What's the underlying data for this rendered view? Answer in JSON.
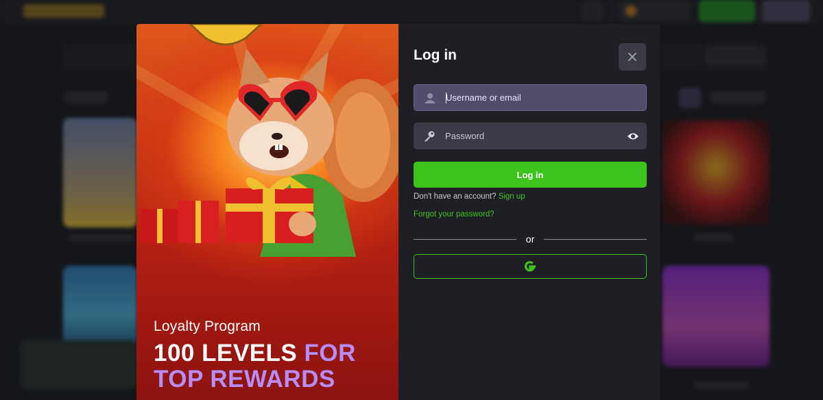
{
  "modal": {
    "title": "Log in",
    "username": {
      "placeholder": "Username or email",
      "value": ""
    },
    "password": {
      "placeholder": "Password",
      "value": ""
    },
    "login_button": "Log in",
    "signup_prompt": "Don't have an account?",
    "signup_link": "Sign up",
    "forgot_link": "Forgot your password?",
    "divider_text": "or",
    "social_login": "google-icon"
  },
  "promo": {
    "subtitle": "Loyalty Program",
    "headline_part1": "100 LEVELS",
    "headline_part2": "FOR",
    "headline_part3": "TOP REWARDS"
  },
  "colors": {
    "accent_green": "#3cc41c",
    "accent_purple": "#b78cf7",
    "panel_bg": "#1e1f24",
    "input_active": "#504e6b",
    "input_bg": "#3a3a48"
  }
}
